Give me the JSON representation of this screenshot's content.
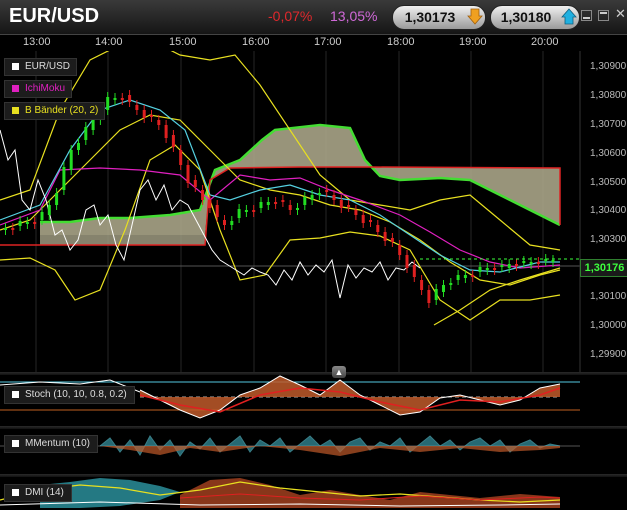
{
  "header": {
    "symbol": "EUR/USD",
    "change": "-0,07%",
    "change_pct": "13,05%",
    "bid": "1,30173",
    "ask": "1,30180"
  },
  "time_axis": [
    "13:00",
    "14:00",
    "15:00",
    "16:00",
    "17:00",
    "18:00",
    "19:00",
    "20:00"
  ],
  "price_axis": [
    "1,30900",
    "1,30800",
    "1,30700",
    "1,30600",
    "1,30500",
    "1,30400",
    "1,30300",
    "1,30200",
    "1,30100",
    "1,30000",
    "1,29900"
  ],
  "current_price": "1,30176",
  "legend": [
    {
      "label": "EUR/USD",
      "color": "#ffffff"
    },
    {
      "label": "IchiMoku",
      "color": "#e020c0"
    },
    {
      "label": "B Bänder (20, 2)",
      "color": "#e8e020"
    }
  ],
  "panels": {
    "stoch": "Stoch (10, 10, 0.8, 0.2)",
    "momentum": "MMentum (10)",
    "dmi": "DMI (14)"
  },
  "colors": {
    "up": "#22dd22",
    "down": "#e02020",
    "cloud_green": "#44dd33",
    "cloud_red": "#dd2222",
    "bollinger": "#e8e020",
    "ichimoku": "#e020c0"
  },
  "icons": {
    "bid_arrow": "down-arrow-icon",
    "ask_arrow": "up-arrow-icon",
    "collapse": "chevron-up-icon"
  }
}
